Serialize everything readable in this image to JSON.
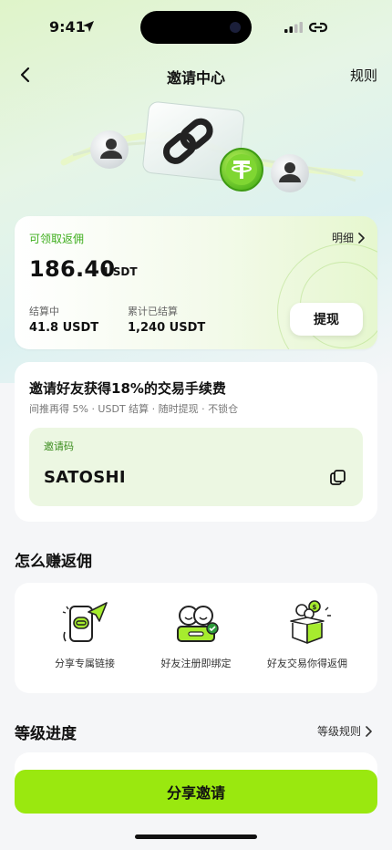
{
  "status_bar": {
    "time": "9:41"
  },
  "nav": {
    "title": "邀请中心",
    "rules_label": "规则"
  },
  "rebate": {
    "label": "可领取返佣",
    "detail_label": "明细",
    "amount": "186.40",
    "unit": "USDT",
    "settling_label": "结算中",
    "settling_value": "41.8 USDT",
    "settled_label": "累计已结算",
    "settled_value": "1,240 USDT",
    "withdraw_label": "提现"
  },
  "invite": {
    "title": "邀请好友获得18%的交易手续费",
    "subtitle": "间推再得 5% · USDT 结算 · 随时提现 · 不锁仓",
    "code_label": "邀请码",
    "code_value": "SATOSHI"
  },
  "how_to_earn": {
    "title": "怎么赚返佣",
    "steps": [
      {
        "label": "分享专属链接",
        "icon": "share-phone-icon"
      },
      {
        "label": "好友注册即绑定",
        "icon": "friends-bind-icon"
      },
      {
        "label": "好友交易你得返佣",
        "icon": "gift-box-coins-icon"
      }
    ]
  },
  "level": {
    "title": "等级进度",
    "rules_label": "等级规则"
  },
  "share_button": {
    "label": "分享邀请"
  },
  "colors": {
    "accent": "#9ae80f",
    "accent_text": "#3fae1e",
    "tether": "#6ed12a"
  }
}
